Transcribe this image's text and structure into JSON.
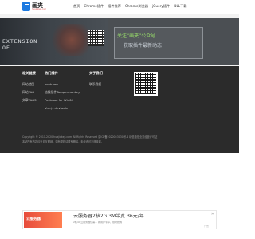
{
  "header": {
    "logo_title": "画夹",
    "logo_sub": "huajiakeji.com",
    "nav": [
      "首页",
      "Chrome插件",
      "插件推荐",
      "Chrome浏览器",
      "jQuery插件",
      "DLL下载"
    ]
  },
  "banner": {
    "ext_text_1": "EXTENSION",
    "ext_text_2": "OF",
    "line1": "关注“画夹”公众号",
    "line2": "获取插件最新动态"
  },
  "footer": {
    "col1": {
      "heading": "相关链接",
      "items": [
        "网站地图",
        "网站TAG",
        "文章TAGS"
      ]
    },
    "col2": {
      "heading": "热门插件",
      "items": [
        "postman",
        "油猴插件Tampermonkey",
        "Postman for Win64",
        "Vue.js devtools"
      ]
    },
    "col3": {
      "heading": "关于我们",
      "items": [
        "联系我们"
      ]
    },
    "copyright_1": "Copyright © 2011-2020 huajiakeji.com All Rights Reserved 京ICP备2020053030号-4 增值电信业务经营许可证",
    "copyright_2": "本站所有内容均来自互联网，如有侵权请联系删除，未经许可不得转载。"
  },
  "ad": {
    "image_text": "云服务器",
    "title": "云服务器2核2G 3M带宽 36元/年",
    "desc": "2核4G云服务器仅需... 新用户专享，限时抢购",
    "close": "✕",
    "label": "广告"
  }
}
